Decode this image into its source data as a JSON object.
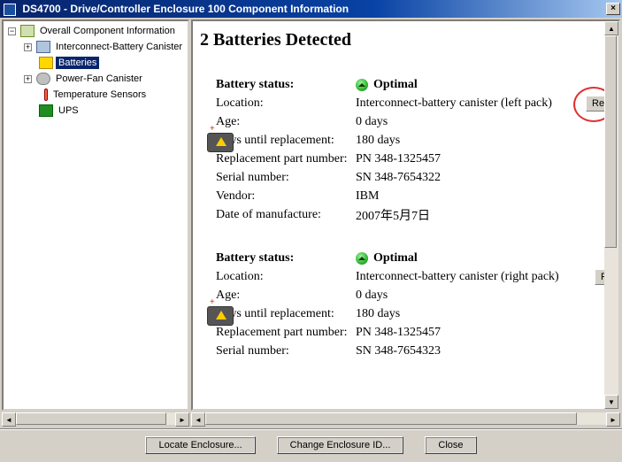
{
  "window": {
    "title": "DS4700 - Drive/Controller Enclosure 100 Component Information",
    "close_label": "×"
  },
  "tree": {
    "root": "Overall Component Information",
    "items": [
      {
        "label": "Interconnect-Battery Canister"
      },
      {
        "label": "Batteries"
      },
      {
        "label": "Power-Fan Canister"
      },
      {
        "label": "Temperature Sensors"
      },
      {
        "label": "UPS"
      }
    ]
  },
  "main": {
    "heading": "2 Batteries Detected",
    "status_label": "Battery status:",
    "status_value": "Optimal",
    "location_label": "Location:",
    "age_label": "Age:",
    "days_label": "Days until replacement:",
    "part_label": "Replacement part number:",
    "serial_label": "Serial number:",
    "vendor_label": "Vendor:",
    "dom_label": "Date of manufacture:",
    "reset_label": "Res",
    "reset_label2": "Re",
    "batteries": [
      {
        "location": "Interconnect-battery canister (left pack)",
        "age": "0 days",
        "days_until": "180 days",
        "part": "PN 348-1325457",
        "serial": "SN 348-7654322",
        "vendor": "IBM",
        "dom": "2007年5月7日"
      },
      {
        "location": "Interconnect-battery canister (right pack)",
        "age": "0 days",
        "days_until": "180 days",
        "part": "PN 348-1325457",
        "serial": "SN 348-7654323"
      }
    ]
  },
  "buttons": {
    "locate": "Locate Enclosure...",
    "change": "Change Enclosure ID...",
    "close": "Close"
  }
}
